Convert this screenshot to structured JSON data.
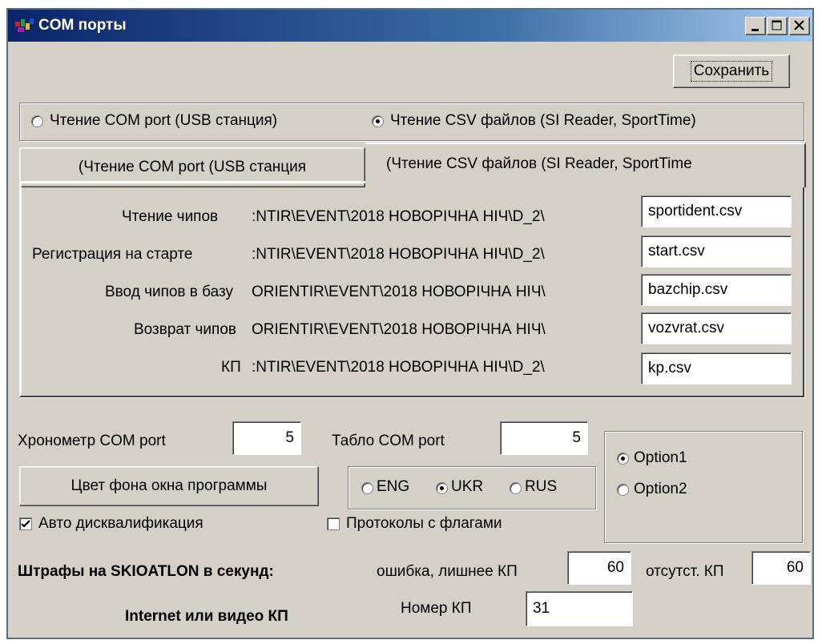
{
  "window": {
    "title": "COM порты",
    "controls": {
      "minimize": "_",
      "maximize": "□",
      "close": "×"
    }
  },
  "save_button": "Сохранить",
  "read_mode": {
    "options": [
      "Чтение COM port (USB станция)",
      "Чтение CSV файлов (SI Reader, SportTime)"
    ],
    "selected": 1
  },
  "tabs": [
    {
      "label": "(Чтение COM port (USB станция"
    },
    {
      "label": "(Чтение CSV файлов (SI Reader, SportTime"
    }
  ],
  "csv_rows": [
    {
      "label": "Чтение чипов",
      "path": ":NTIR\\EVENT\\2018 НОВОРІЧНА НІЧ\\D_2\\",
      "file": "sportident.csv"
    },
    {
      "label": "Регистрация на старте",
      "path": ":NTIR\\EVENT\\2018 НОВОРІЧНА НІЧ\\D_2\\",
      "file": "start.csv"
    },
    {
      "label": "Ввод чипов в базу",
      "path": "ORIENTIR\\EVENT\\2018 НОВОРІЧНА НІЧ\\",
      "file": "bazchip.csv"
    },
    {
      "label": "Возврат чипов",
      "path": "ORIENTIR\\EVENT\\2018 НОВОРІЧНА НІЧ\\",
      "file": "vozvrat.csv"
    },
    {
      "label": "КП",
      "path": ":NTIR\\EVENT\\2018 НОВОРІЧНА НІЧ\\D_2\\",
      "file": "kp.csv"
    }
  ],
  "chronometer": {
    "label": "Хронометр COM port",
    "value": "5"
  },
  "tablo": {
    "label": "Табло  COM port",
    "value": "5"
  },
  "bg_color_button": "Цвет фона окна программы",
  "language": {
    "options": [
      "ENG",
      "UKR",
      "RUS"
    ],
    "selected": 1
  },
  "option_group": {
    "options": [
      "Option1",
      "Option2"
    ],
    "selected": 0
  },
  "auto_dq": {
    "label": "Авто дисквалификация",
    "checked": true
  },
  "flags_protocols": {
    "label": "Протоколы с флагами",
    "checked": false
  },
  "penalties": {
    "label": "Штрафы на SKIOATLON в секунд:",
    "error_label": "ошибка, лишнее КП",
    "error_value": "60",
    "missing_label": "отсутст. КП",
    "missing_value": "60"
  },
  "internet": {
    "label": "Internet или видео КП",
    "kp_label": "Номер КП",
    "kp_value": "31"
  }
}
